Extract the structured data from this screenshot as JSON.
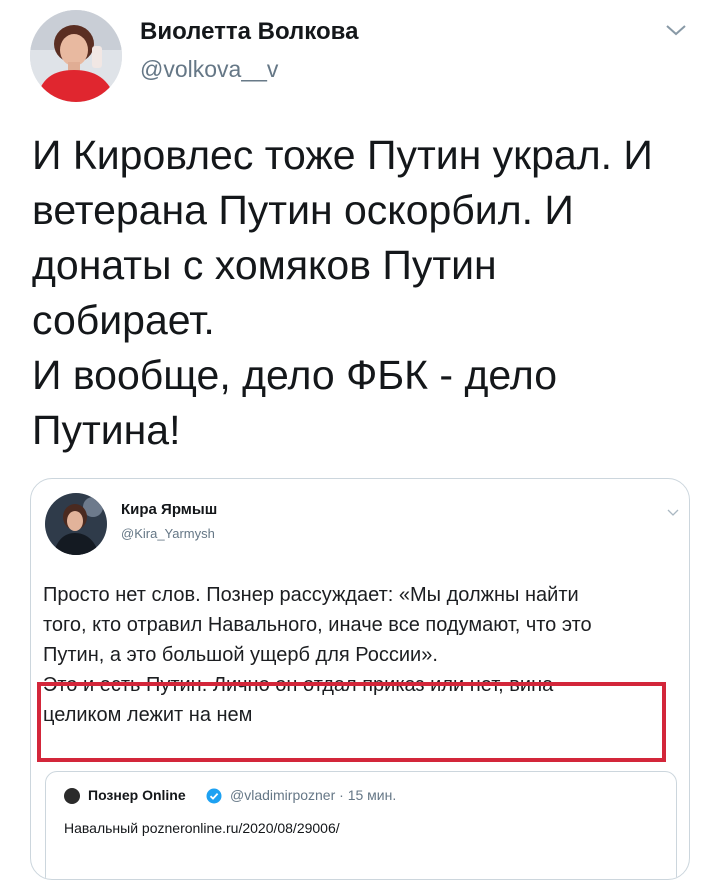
{
  "tweet": {
    "author_name": "Виолетта Волкова",
    "author_handle": "@volkova__v",
    "lines": [
      "И Кировлес тоже Путин украл. И",
      "ветерана Путин оскорбил.  И",
      "донаты с хомяков Путин",
      "собирает.",
      "И вообще, дело ФБК - дело",
      "Путина!"
    ]
  },
  "quoted": {
    "author_name": "Кира Ярмыш",
    "author_handle": "@Kira_Yarmysh",
    "lines": [
      "Просто нет слов. Познер рассуждает: «Мы должны найти",
      "того, кто отравил Навального, иначе все подумают, что это",
      "Путин, а это большой ущерб для России».",
      "Это и есть Путин. Лично он отдал приказ или нет, вина",
      "целиком лежит на нем"
    ],
    "highlight_color": "#d3263a",
    "inner": {
      "author_name": "Познер Online",
      "meta": "@vladimirpozner · 15 мин.",
      "text": "Навальный pozneronline.ru/2020/08/29006/"
    }
  },
  "colors": {
    "text": "#14171a",
    "secondary": "#657786",
    "border": "#ccd6dd",
    "verified": "#1da1f2"
  },
  "icons": {
    "menu": "chevron-down-icon",
    "verified": "verified-badge-icon"
  }
}
